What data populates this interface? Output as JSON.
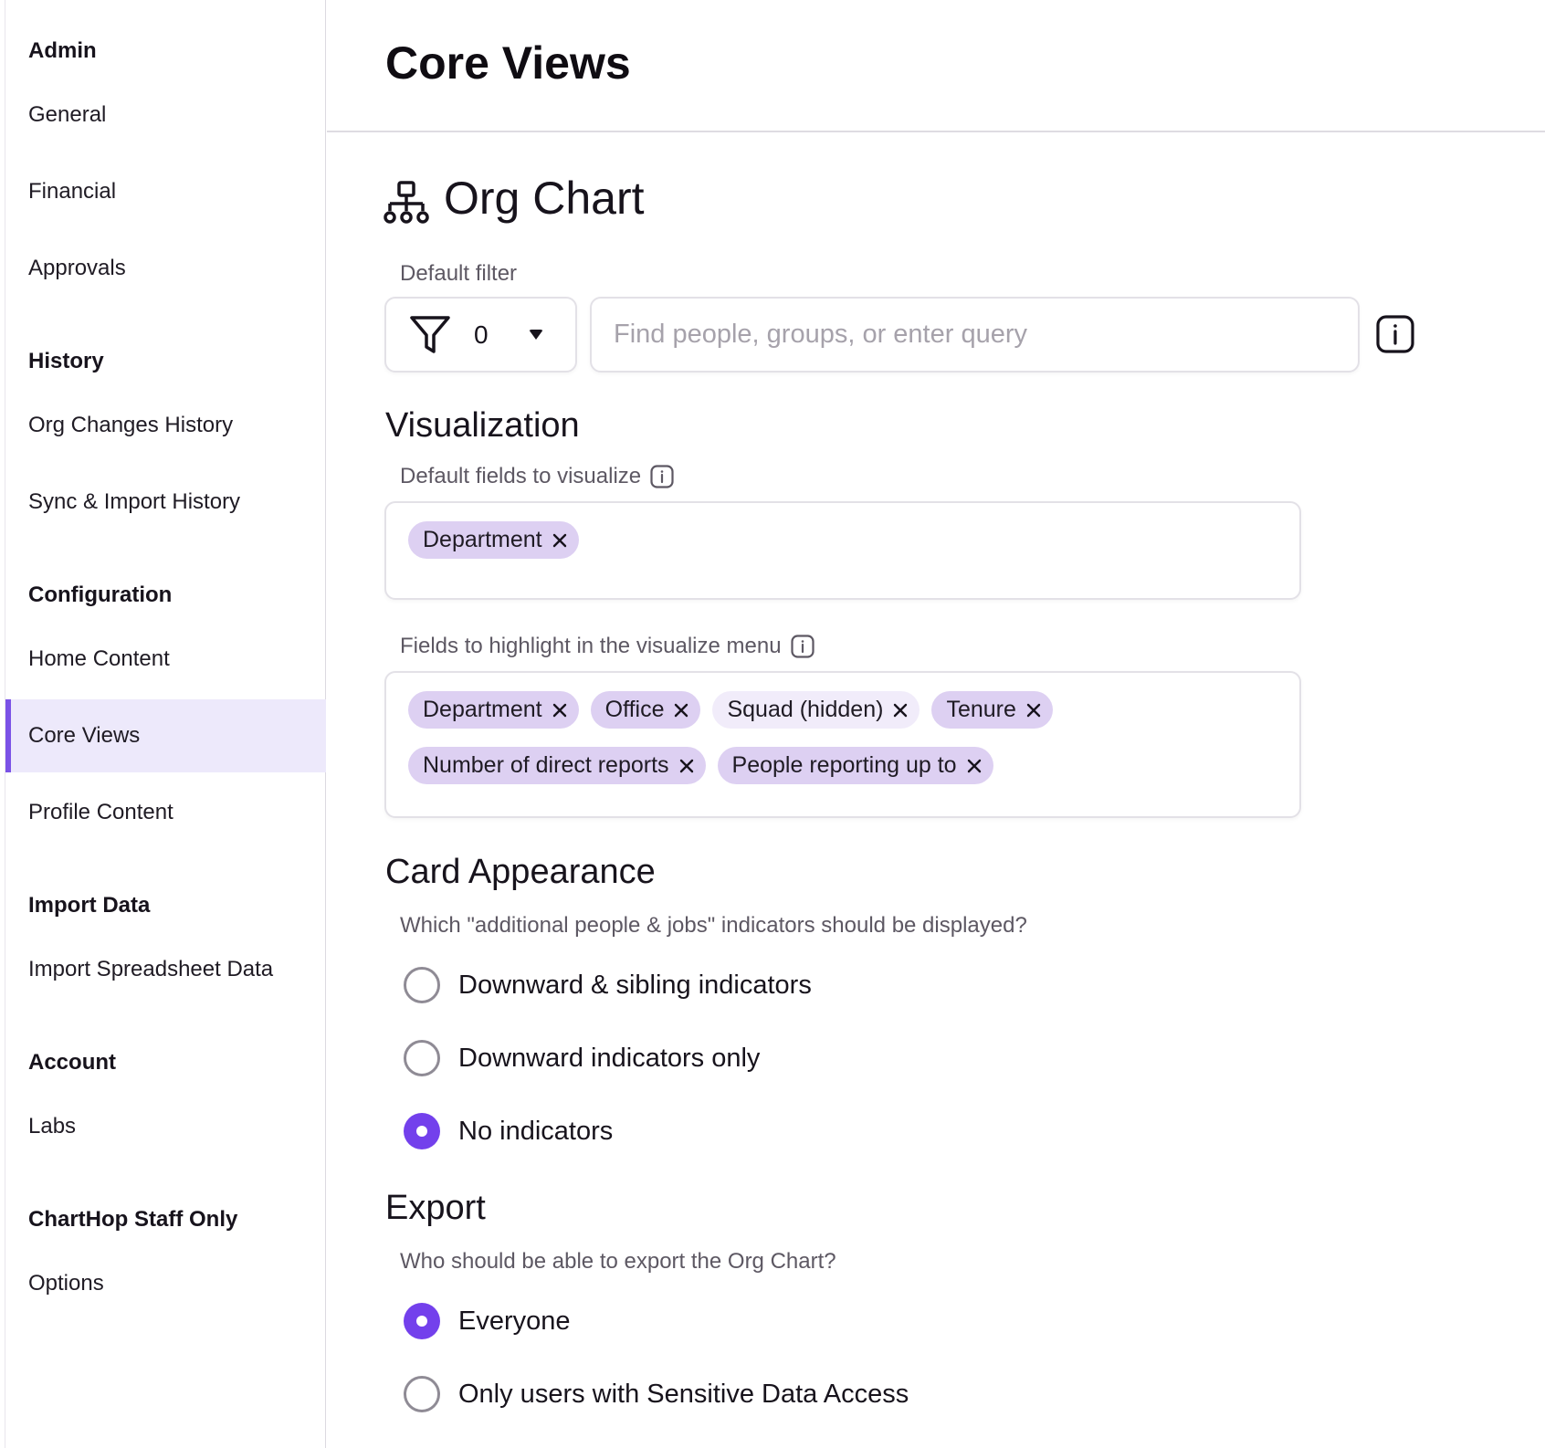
{
  "sidebar": {
    "sections": [
      {
        "heading": "Admin",
        "items": [
          "General",
          "Financial",
          "Approvals"
        ]
      },
      {
        "heading": "History",
        "items": [
          "Org Changes History",
          "Sync & Import History"
        ]
      },
      {
        "heading": "Configuration",
        "items": [
          "Home Content",
          "Core Views",
          "Profile Content"
        ]
      },
      {
        "heading": "Import Data",
        "items": [
          "Import Spreadsheet Data"
        ]
      },
      {
        "heading": "Account",
        "items": [
          "Labs"
        ]
      },
      {
        "heading": "ChartHop Staff Only",
        "items": [
          "Options"
        ]
      }
    ],
    "active_item": "Core Views"
  },
  "page": {
    "title": "Core Views"
  },
  "org_chart": {
    "title": "Org Chart",
    "default_filter": {
      "label": "Default filter",
      "count": "0",
      "search_placeholder": "Find people, groups, or enter query"
    }
  },
  "visualization": {
    "title": "Visualization",
    "default_fields_label": "Default fields to visualize",
    "default_fields": [
      "Department"
    ],
    "highlight_label": "Fields to highlight in the visualize menu",
    "highlight_fields_row1": [
      "Department",
      "Office",
      "Squad (hidden)",
      "Tenure"
    ],
    "highlight_fields_row2": [
      "Number of direct reports",
      "People reporting up to"
    ]
  },
  "card_appearance": {
    "title": "Card Appearance",
    "question": "Which \"additional people & jobs\" indicators should be displayed?",
    "options": [
      "Downward & sibling indicators",
      "Downward indicators only",
      "No indicators"
    ],
    "selected": "No indicators"
  },
  "export": {
    "title": "Export",
    "question": "Who should be able to export the Org Chart?",
    "options": [
      "Everyone",
      "Only users with Sensitive Data Access"
    ],
    "selected": "Everyone"
  },
  "colors": {
    "accent": "#7340ec",
    "chip": "#ddd0f2",
    "active_bg": "#ede9fb"
  }
}
